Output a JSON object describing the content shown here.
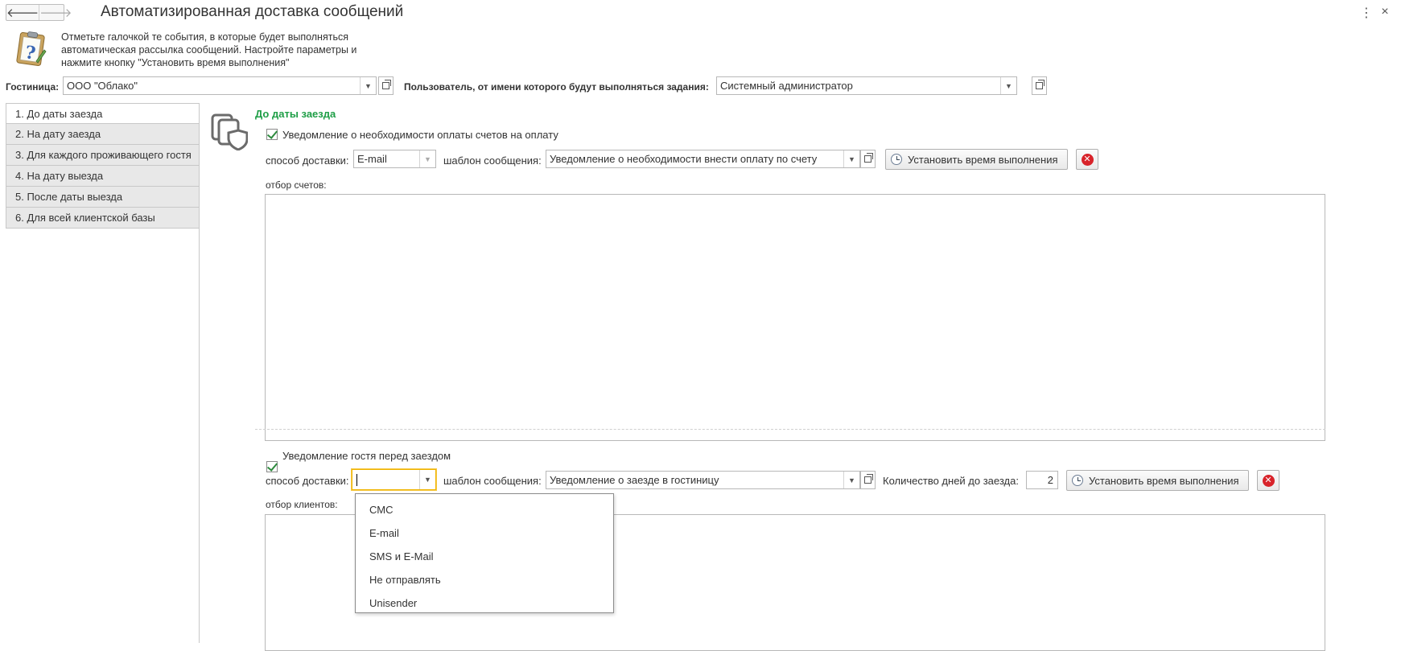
{
  "window": {
    "title": "Автоматизированная доставка сообщений",
    "back_glyph": "🡐",
    "forward_glyph": "🡒",
    "menu_glyph": "⋮",
    "close_glyph": "×"
  },
  "info": {
    "icon": "clipboard-question-icon",
    "text": "Отметьте галочкой те события, в которые будет выполняться автоматическая рассылка сообщений. Настройте параметры и нажмите кнопку \"Установить время выполнения\""
  },
  "filters": {
    "hotel_label": "Гостиница:",
    "hotel_value": "ООО \"Облако\"",
    "user_label": "Пользователь, от имени которого будут выполняться задания:",
    "user_value": "Системный администратор"
  },
  "tabs": [
    {
      "label": "1. До даты заезда",
      "active": true
    },
    {
      "label": "2. На дату заезда",
      "active": false
    },
    {
      "label": "3. Для каждого проживающего гостя",
      "active": false
    },
    {
      "label": "4. На дату выезда",
      "active": false
    },
    {
      "label": "5. После даты выезда",
      "active": false
    },
    {
      "label": "6. Для всей клиентской базы",
      "active": false
    }
  ],
  "section": {
    "title": "До даты заезда",
    "icon": "documents-shield-icon",
    "block1": {
      "checkbox_label": "Уведомление о необходимости оплаты счетов на оплату",
      "checked": true,
      "delivery_label": "способ доставки:",
      "delivery_value": "E-mail",
      "template_label": "шаблон сообщения:",
      "template_value": "Уведомление о необходимости внести оплату по счету",
      "schedule_button": "Установить время выполнения",
      "filter_label": "отбор счетов:"
    },
    "block2": {
      "checkbox_label": "Уведомление гостя перед заездом",
      "checked": true,
      "delivery_label": "способ доставки:",
      "delivery_value": "",
      "template_label": "шаблон сообщения:",
      "template_value": "Уведомление о заезде в гостиницу",
      "days_label": "Количество дней до заезда:",
      "days_value": "2",
      "schedule_button": "Установить время выполнения",
      "filter_label": "отбор клиентов:"
    }
  },
  "dropdown": {
    "options": [
      "СМС",
      "E-mail",
      "SMS и E-Mail",
      "Не отправлять",
      "Unisender"
    ]
  },
  "colors": {
    "section_title": "#1e9e46",
    "focus_border": "#f0b400",
    "delete_icon": "#d8232a",
    "tab_inactive": "#e8e8e8"
  }
}
